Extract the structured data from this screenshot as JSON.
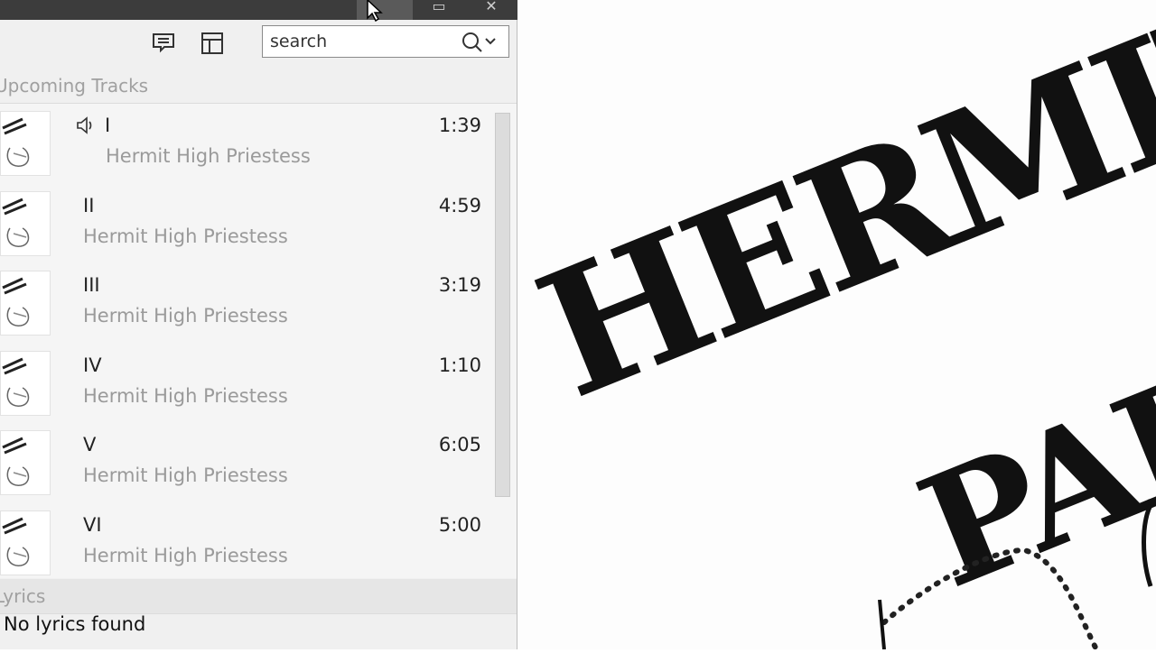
{
  "window": {
    "maximize_glyph": "▭",
    "close_glyph": "✕"
  },
  "toolbar": {
    "lyrics_icon": "comment-icon",
    "layout_icon": "layout-icon"
  },
  "search": {
    "placeholder": "search",
    "value": ""
  },
  "upcoming": {
    "header": "Upcoming Tracks",
    "tracks": [
      {
        "title": "I",
        "artist": "Hermit High Priestess",
        "duration": "1:39",
        "playing": true
      },
      {
        "title": "II",
        "artist": "Hermit High Priestess",
        "duration": "4:59",
        "playing": false
      },
      {
        "title": "III",
        "artist": "Hermit High Priestess",
        "duration": "3:19",
        "playing": false
      },
      {
        "title": "IV",
        "artist": "Hermit High Priestess",
        "duration": "1:10",
        "playing": false
      },
      {
        "title": "V",
        "artist": "Hermit High Priestess",
        "duration": "6:05",
        "playing": false
      },
      {
        "title": "VI",
        "artist": "Hermit High Priestess",
        "duration": "5:00",
        "playing": false
      }
    ]
  },
  "lyrics": {
    "header": "Lyrics",
    "message": "No lyrics found"
  },
  "album_art": {
    "lines": [
      "HERMIT",
      "PAPE"
    ]
  }
}
